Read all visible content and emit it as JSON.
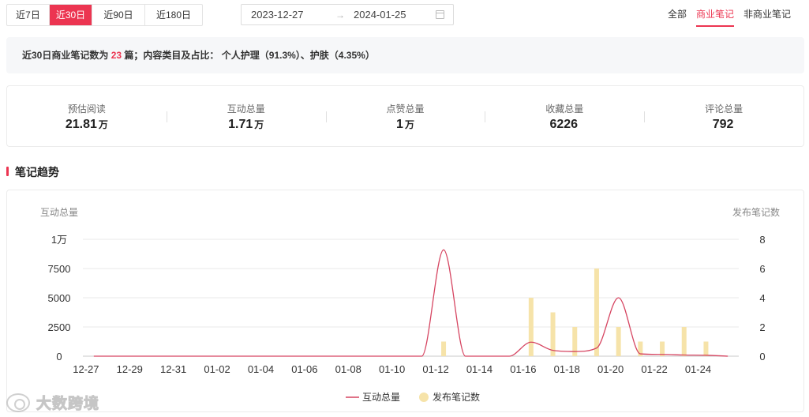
{
  "range_tabs": [
    {
      "label": "近7日",
      "active": false
    },
    {
      "label": "近30日",
      "active": true
    },
    {
      "label": "近90日",
      "active": false
    },
    {
      "label": "近180日",
      "active": false
    }
  ],
  "date_range": {
    "start": "2023-12-27",
    "arrow": "→",
    "end": "2024-01-25",
    "icon": "calendar-icon"
  },
  "type_tabs": [
    {
      "label": "全部",
      "active": false
    },
    {
      "label": "商业笔记",
      "active": true
    },
    {
      "label": "非商业笔记",
      "active": false
    }
  ],
  "summary": {
    "prefix": "近30日商业笔记数为",
    "count": "23",
    "suffix": "篇；内容类目及占比：",
    "categories": "个人护理（91.3%）、护肤（4.35%）"
  },
  "stats": [
    {
      "label": "预估阅读",
      "value": "21.81",
      "unit": "万"
    },
    {
      "label": "互动总量",
      "value": "1.71",
      "unit": "万"
    },
    {
      "label": "点赞总量",
      "value": "1",
      "unit": "万"
    },
    {
      "label": "收藏总量",
      "value": "6226",
      "unit": ""
    },
    {
      "label": "评论总量",
      "value": "792",
      "unit": ""
    }
  ],
  "section_title": "笔记趋势",
  "watermark": "大数跨境",
  "colors": {
    "accent": "#ec3551",
    "line": "#d64561",
    "bar": "#f6e3a9"
  },
  "chart_data": {
    "type": "line+bar",
    "x": [
      "12-27",
      "12-28",
      "12-29",
      "12-30",
      "12-31",
      "01-01",
      "01-02",
      "01-03",
      "01-04",
      "01-05",
      "01-06",
      "01-07",
      "01-08",
      "01-09",
      "01-10",
      "01-11",
      "01-12",
      "01-13",
      "01-14",
      "01-15",
      "01-16",
      "01-17",
      "01-18",
      "01-19",
      "01-20",
      "01-21",
      "01-22",
      "01-23",
      "01-24",
      "01-25"
    ],
    "x_tick_labels": [
      "12-27",
      "12-29",
      "12-31",
      "01-02",
      "01-04",
      "01-06",
      "01-08",
      "01-10",
      "01-12",
      "01-14",
      "01-16",
      "01-18",
      "01-20",
      "01-22",
      "01-24"
    ],
    "y_left_label": "互动总量",
    "y_left_ticks": [
      "0",
      "2500",
      "5000",
      "7500",
      "1万"
    ],
    "y_left_lim": [
      0,
      10000
    ],
    "y_right_label": "发布笔记数",
    "y_right_ticks": [
      "0",
      "2",
      "4",
      "6",
      "8"
    ],
    "y_right_lim": [
      0,
      8
    ],
    "series": [
      {
        "name": "互动总量",
        "kind": "line",
        "values": [
          0,
          0,
          0,
          0,
          0,
          0,
          0,
          0,
          0,
          0,
          0,
          0,
          0,
          0,
          0,
          0,
          9100,
          0,
          0,
          0,
          1200,
          500,
          400,
          700,
          5000,
          200,
          150,
          100,
          80,
          0
        ]
      },
      {
        "name": "发布笔记数",
        "kind": "bar",
        "values": [
          0,
          0,
          0,
          0,
          0,
          0,
          0,
          0,
          0,
          0,
          0,
          0,
          0,
          0,
          0,
          0,
          1,
          0,
          0,
          0,
          4,
          3,
          2,
          6,
          2,
          1,
          1,
          2,
          1,
          0
        ]
      }
    ],
    "legend_position": "bottom-center",
    "grid": true
  }
}
